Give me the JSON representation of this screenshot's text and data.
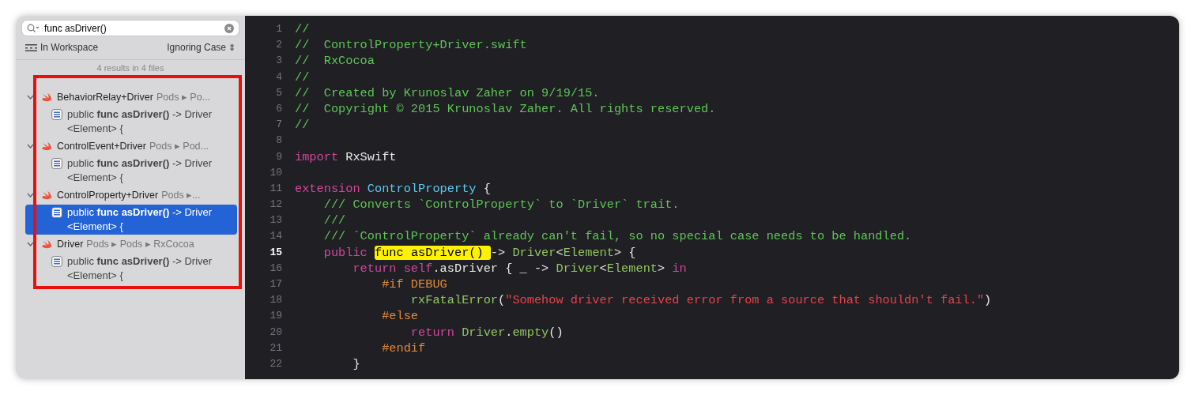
{
  "sidebar": {
    "search": {
      "value": "func asDriver()"
    },
    "scope": "In Workspace",
    "matching": "Ignoring Case",
    "matching_icon": "⇕",
    "summary": "4 results in 4 files",
    "results": [
      {
        "file": "BehaviorRelay+Driver",
        "path": "Pods ▸ Po...",
        "expanded": true,
        "children": [
          {
            "text": "public **func asDriver()** -> Driver<Element> {",
            "selected": false
          }
        ]
      },
      {
        "file": "ControlEvent+Driver",
        "path": "Pods ▸ Pod...",
        "expanded": true,
        "children": [
          {
            "text": "public **func asDriver()** -> Driver<Element> {",
            "selected": false
          }
        ]
      },
      {
        "file": "ControlProperty+Driver",
        "path": "Pods ▸...",
        "expanded": true,
        "children": [
          {
            "text": "public **func asDriver()** -> Driver<Element> {",
            "selected": true
          }
        ]
      },
      {
        "file": "Driver",
        "path": "Pods ▸ Pods ▸ RxCocoa",
        "expanded": true,
        "children": [
          {
            "text": "public **func asDriver()** -> Driver<Element> {",
            "selected": false
          }
        ]
      }
    ]
  },
  "editor": {
    "lines": [
      {
        "number": "1",
        "current": false,
        "tokens": [
          {
            "kind": "comment",
            "text": "//"
          }
        ]
      },
      {
        "number": "2",
        "current": false,
        "tokens": [
          {
            "kind": "comment",
            "text": "//  ControlProperty+Driver.swift"
          }
        ]
      },
      {
        "number": "3",
        "current": false,
        "tokens": [
          {
            "kind": "comment",
            "text": "//  RxCocoa"
          }
        ]
      },
      {
        "number": "4",
        "current": false,
        "tokens": [
          {
            "kind": "comment",
            "text": "//"
          }
        ]
      },
      {
        "number": "5",
        "current": false,
        "tokens": [
          {
            "kind": "comment",
            "text": "//  Created by Krunoslav Zaher on 9/19/15."
          }
        ]
      },
      {
        "number": "6",
        "current": false,
        "tokens": [
          {
            "kind": "comment",
            "text": "//  Copyright © 2015 Krunoslav Zaher. All rights reserved."
          }
        ]
      },
      {
        "number": "7",
        "current": false,
        "tokens": [
          {
            "kind": "comment",
            "text": "//"
          }
        ]
      },
      {
        "number": "8",
        "current": false
      },
      {
        "number": "9",
        "current": false,
        "tokens": [
          {
            "kind": "keyword",
            "text": "import"
          },
          {
            "kind": "plain",
            "text": " RxSwift"
          }
        ]
      },
      {
        "number": "10",
        "current": false
      },
      {
        "number": "11",
        "current": false,
        "tokens": [
          {
            "kind": "keyword",
            "text": "extension "
          },
          {
            "kind": "decl",
            "text": "ControlProperty"
          },
          {
            "kind": "plain",
            "text": " {"
          }
        ]
      },
      {
        "number": "12",
        "current": false,
        "tokens": [
          {
            "kind": "doc",
            "text": "    /// Converts `ControlProperty` to `Driver` trait."
          }
        ]
      },
      {
        "number": "13",
        "current": false,
        "tokens": [
          {
            "kind": "doc",
            "text": "    ///"
          }
        ]
      },
      {
        "number": "14",
        "current": false,
        "tokens": [
          {
            "kind": "doc",
            "text": "    /// `ControlProperty` already can't fail, so no special case needs to be handled."
          }
        ]
      },
      {
        "number": "15",
        "current": true,
        "tokens": [
          {
            "kind": "keyword",
            "text": "    public "
          },
          {
            "kind": "match",
            "text": "func asDriver() "
          },
          {
            "kind": "plain",
            "text": "-> "
          },
          {
            "kind": "type",
            "text": "Driver"
          },
          {
            "kind": "plain",
            "text": "<"
          },
          {
            "kind": "type",
            "text": "Element"
          },
          {
            "kind": "plain",
            "text": "> {"
          }
        ]
      },
      {
        "number": "16",
        "current": false,
        "tokens": [
          {
            "kind": "keyword",
            "text": "        return self"
          },
          {
            "kind": "plain",
            "text": ".asDriver { _ -> "
          },
          {
            "kind": "type",
            "text": "Driver"
          },
          {
            "kind": "plain",
            "text": "<"
          },
          {
            "kind": "type",
            "text": "Element"
          },
          {
            "kind": "plain",
            "text": "> "
          },
          {
            "kind": "keyword",
            "text": "in"
          }
        ]
      },
      {
        "number": "17",
        "current": false,
        "tokens": [
          {
            "kind": "preproc",
            "text": "            #if DEBUG"
          }
        ]
      },
      {
        "number": "18",
        "current": false,
        "tokens": [
          {
            "kind": "type",
            "text": "                rxFatalError"
          },
          {
            "kind": "plain",
            "text": "("
          },
          {
            "kind": "string",
            "text": "\"Somehow driver received error from a source that shouldn't fail.\""
          },
          {
            "kind": "plain",
            "text": ")"
          }
        ]
      },
      {
        "number": "19",
        "current": false,
        "tokens": [
          {
            "kind": "preproc",
            "text": "            #else"
          }
        ]
      },
      {
        "number": "20",
        "current": false,
        "tokens": [
          {
            "kind": "keyword",
            "text": "                return "
          },
          {
            "kind": "type",
            "text": "Driver"
          },
          {
            "kind": "plain",
            "text": "."
          },
          {
            "kind": "type",
            "text": "empty"
          },
          {
            "kind": "plain",
            "text": "()"
          }
        ]
      },
      {
        "number": "21",
        "current": false,
        "tokens": [
          {
            "kind": "preproc",
            "text": "            #endif"
          }
        ]
      },
      {
        "number": "22",
        "current": false,
        "tokens": [
          {
            "kind": "plain",
            "text": "        }"
          }
        ]
      }
    ]
  }
}
